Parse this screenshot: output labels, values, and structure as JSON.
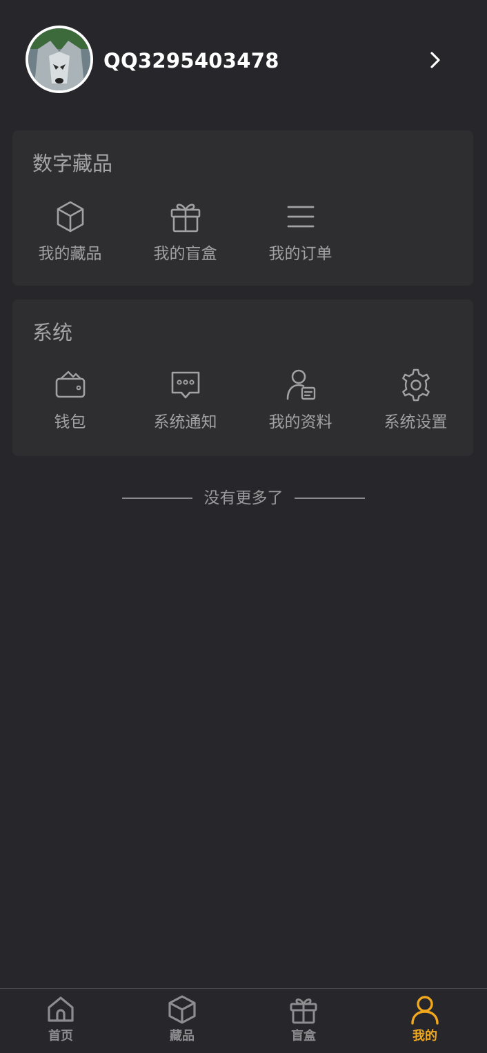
{
  "profile": {
    "username": "QQ3295403478"
  },
  "digital_collections": {
    "title": "数字藏品",
    "items": [
      {
        "label": "我的藏品",
        "icon": "cube-icon"
      },
      {
        "label": "我的盲盒",
        "icon": "gift-icon"
      },
      {
        "label": "我的订单",
        "icon": "list-icon"
      }
    ]
  },
  "system": {
    "title": "系统",
    "items": [
      {
        "label": "钱包",
        "icon": "wallet-icon"
      },
      {
        "label": "系统通知",
        "icon": "message-icon"
      },
      {
        "label": "我的资料",
        "icon": "profile-card-icon"
      },
      {
        "label": "系统设置",
        "icon": "gear-icon"
      }
    ]
  },
  "no_more_text": "没有更多了",
  "tabbar": {
    "active_index": 3,
    "active_color": "#f2a81d",
    "inactive_color": "#8d8d90",
    "tabs": [
      {
        "label": "首页",
        "icon": "home-icon"
      },
      {
        "label": "藏品",
        "icon": "cube-icon"
      },
      {
        "label": "盲盒",
        "icon": "gift-icon"
      },
      {
        "label": "我的",
        "icon": "user-icon"
      }
    ]
  },
  "colors": {
    "background": "#26262b",
    "card": "#2e2e31",
    "accent": "#f2a81d"
  }
}
